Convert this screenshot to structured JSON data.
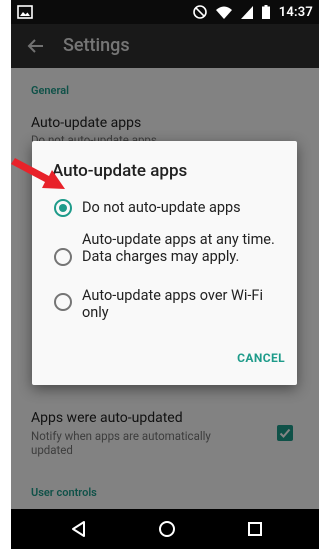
{
  "status_bar": {
    "time": "14:37"
  },
  "toolbar": {
    "title": "Settings"
  },
  "settings": {
    "general_header": "General",
    "auto_update_title": "Auto-update apps",
    "auto_update_summary": "Do not auto-update apps",
    "auto_updated_title": "Apps were auto-updated",
    "auto_updated_summary": "Notify when apps are automatically updated",
    "auto_updated_checked": true,
    "user_controls_header": "User controls"
  },
  "dialog": {
    "title": "Auto-update apps",
    "options": [
      {
        "label": "Do not auto-update apps",
        "selected": true
      },
      {
        "label": "Auto-update apps at any time. Data charges may apply.",
        "selected": false
      },
      {
        "label": "Auto-update apps over Wi-Fi only",
        "selected": false
      }
    ],
    "cancel_label": "CANCEL"
  },
  "colors": {
    "accent": "#1e9b8a",
    "toolbar": "#303030",
    "annotation_arrow": "#e8222a"
  },
  "icons": {
    "status_left": "image-icon",
    "status_right": [
      "do-not-disturb-icon",
      "wifi-icon",
      "signal-icon",
      "battery-icon"
    ],
    "nav": [
      "back-triangle-icon",
      "home-circle-icon",
      "recents-square-icon"
    ]
  }
}
